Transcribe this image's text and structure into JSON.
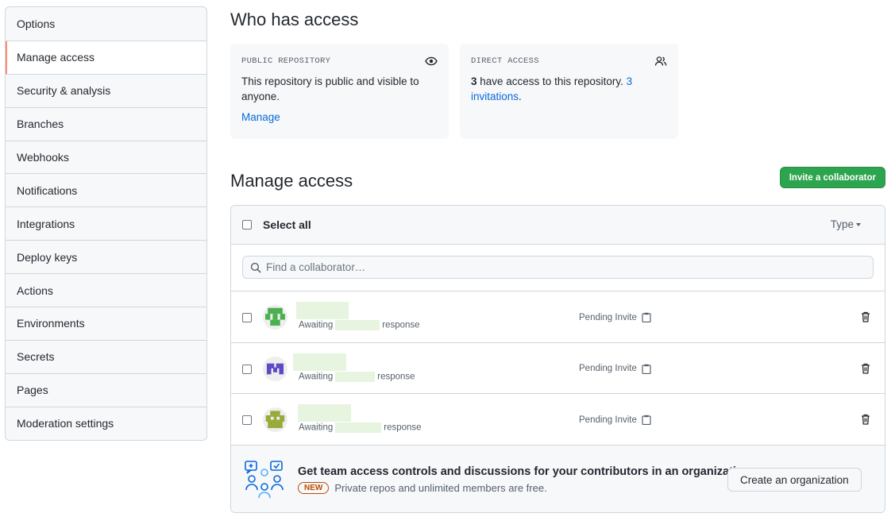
{
  "sidebar": {
    "items": [
      {
        "label": "Options"
      },
      {
        "label": "Manage access",
        "selected": true
      },
      {
        "label": "Security & analysis"
      },
      {
        "label": "Branches"
      },
      {
        "label": "Webhooks"
      },
      {
        "label": "Notifications"
      },
      {
        "label": "Integrations"
      },
      {
        "label": "Deploy keys"
      },
      {
        "label": "Actions"
      },
      {
        "label": "Environments"
      },
      {
        "label": "Secrets"
      },
      {
        "label": "Pages"
      },
      {
        "label": "Moderation settings"
      }
    ]
  },
  "who_has_access": {
    "title": "Who has access",
    "public_card": {
      "label": "PUBLIC REPOSITORY",
      "icon": "eye-icon",
      "text": "This repository is public and visible to anyone.",
      "link": "Manage"
    },
    "direct_card": {
      "label": "DIRECT ACCESS",
      "icon": "people-icon",
      "count": "3",
      "text": " have access to this repository. ",
      "link": "3 invitations",
      "suffix": "."
    }
  },
  "manage_access": {
    "title": "Manage access",
    "invite_button": "Invite a collaborator",
    "select_all": "Select all",
    "type_filter": "Type",
    "search_placeholder": "Find a collaborator…",
    "members": [
      {
        "awaiting": "Awaiting",
        "response": "response",
        "status": "Pending Invite",
        "avatar_color": "#4caf50"
      },
      {
        "awaiting": "Awaiting",
        "response": "response",
        "status": "Pending Invite",
        "avatar_color": "#5b4bc4"
      },
      {
        "awaiting": "Awaiting",
        "response": "response",
        "status": "Pending Invite",
        "avatar_color": "#9aaa3a"
      }
    ],
    "upsell": {
      "title": "Get team access controls and discussions for your contributors in an organization.",
      "badge": "NEW",
      "subtitle": "Private repos and unlimited members are free.",
      "button": "Create an organization"
    }
  },
  "colors": {
    "accent": "#0969da",
    "primary_button": "#2da44e",
    "selected_marker": "#fd8c73",
    "new_badge": "#bc4c00"
  }
}
